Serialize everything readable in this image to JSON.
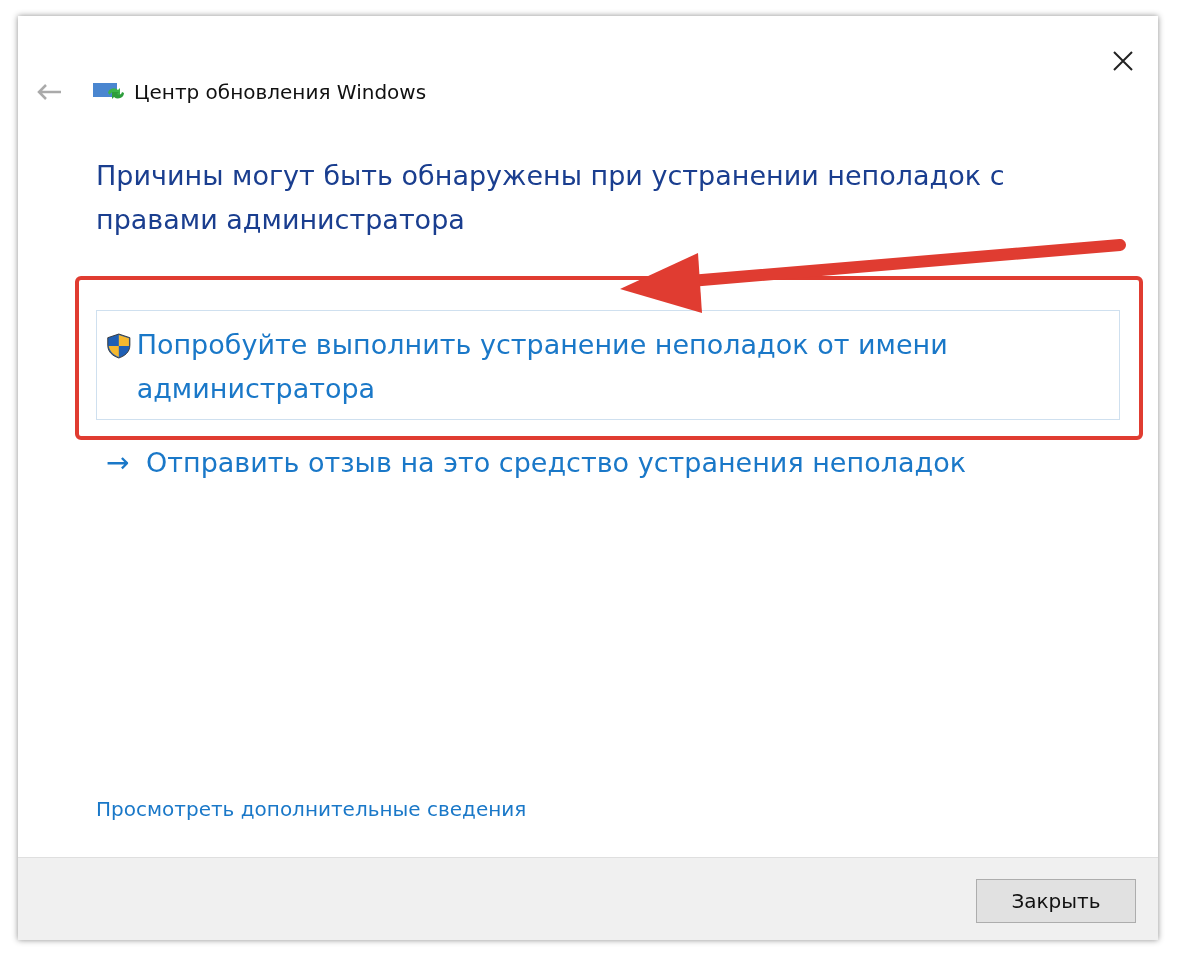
{
  "window": {
    "title": "Центр обновления Windows"
  },
  "heading": "Причины могут быть обнаружены при устранении неполадок с правами администратора",
  "admin_option": {
    "label": "Попробуйте выполнить устранение неполадок от имени администратора",
    "highlighted": true
  },
  "feedback_link": {
    "arrow": "→",
    "label": "Отправить отзыв на это средство устранения неполадок"
  },
  "details_link": "Просмотреть дополнительные сведения",
  "buttons": [
    "Закрыть"
  ]
}
